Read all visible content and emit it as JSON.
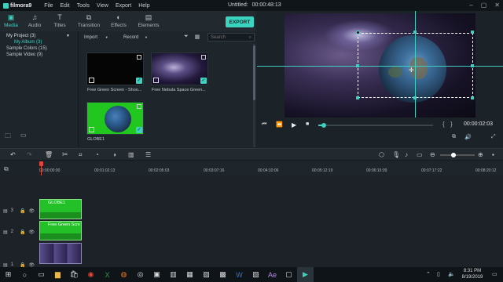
{
  "app": {
    "logo": "filmora9",
    "title": "Untitled:",
    "timecode": "00:00:48:13",
    "menu": [
      "File",
      "Edit",
      "Tools",
      "View",
      "Export",
      "Help"
    ]
  },
  "tabs": [
    {
      "label": "Media",
      "icon": "media-icon",
      "active": true
    },
    {
      "label": "Audio",
      "icon": "music-note-icon",
      "active": false
    },
    {
      "label": "Titles",
      "icon": "text-icon",
      "active": false
    },
    {
      "label": "Transition",
      "icon": "transition-icon",
      "active": false
    },
    {
      "label": "Effects",
      "icon": "effects-icon",
      "active": false
    },
    {
      "label": "Elements",
      "icon": "elements-icon",
      "active": false
    }
  ],
  "export_label": "EXPORT",
  "sidebar": {
    "project": "My Project (3)",
    "album": "My Album (3)",
    "colors": "Sample Colors (15)",
    "video": "Sample Video (9)"
  },
  "mediabar": {
    "import": "Import",
    "record": "Record",
    "search_placeholder": "Search"
  },
  "media": [
    {
      "caption": "Free Green Screen - Shoo...",
      "kind": "black"
    },
    {
      "caption": "Free Nebula Space Green...",
      "kind": "nebula"
    },
    {
      "caption": "GLOBE1",
      "kind": "globe"
    }
  ],
  "preview": {
    "time": "00:00:02:03",
    "progress": 0.05
  },
  "ruler": [
    "00:00:00:00",
    "00:01:02:13",
    "00:02:05:03",
    "00:03:07:16",
    "00:04:10:06",
    "00:05:12:19",
    "00:06:15:09",
    "00:07:17:22",
    "00:08:20:12"
  ],
  "tracks": [
    {
      "num": "3",
      "clip": "GLOBE1"
    },
    {
      "num": "2",
      "clip": "Free Green Scre"
    },
    {
      "num": "1",
      "clip": ""
    }
  ],
  "taskbar": {
    "time": "8:31 PM",
    "date": "8/19/2019"
  },
  "colors": {
    "accent": "#3fd0c0",
    "export_bg": "#3bd4c1",
    "playhead": "#e0473c"
  }
}
